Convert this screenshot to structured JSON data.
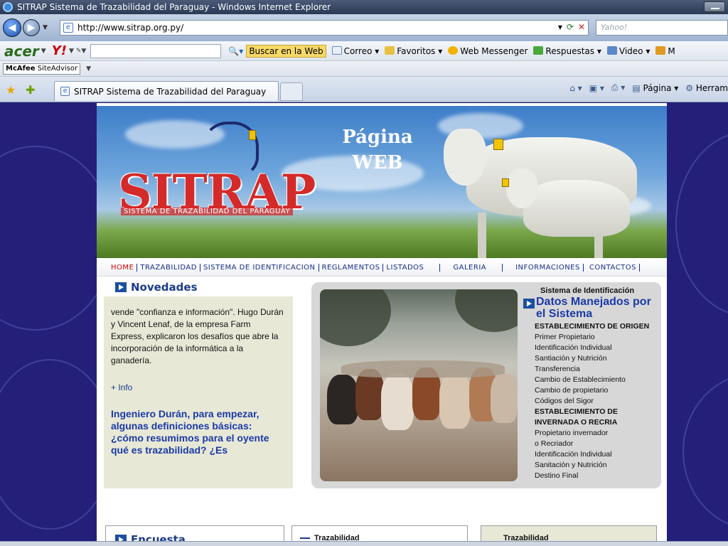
{
  "window": {
    "title": "SITRAP Sistema de Trazabilidad del Paraguay - Windows Internet Explorer"
  },
  "address_bar": {
    "url": "http://www.sitrap.org.py/",
    "search_placeholder": "Yahoo!"
  },
  "toolbar": {
    "brand": "acer",
    "yahoo": "Y!",
    "buscar_label": "Buscar en la Web",
    "items": [
      "Correo",
      "Favoritos",
      "Web Messenger",
      "Respuestas",
      "Video",
      "M"
    ]
  },
  "mcafee": {
    "brand": "McAfee",
    "label": "SiteAdvisor"
  },
  "tabs": {
    "active_label": "SITRAP Sistema de Trazabilidad del Paraguay",
    "commands": [
      "Página",
      "Herram"
    ]
  },
  "banner": {
    "logo_text": "SITRAP",
    "logo_subtitle": "SISTEMA DE TRAZABILIDAD DEL PARAGUAY",
    "overlay_line1": "Página",
    "overlay_line2": "WEB"
  },
  "menu": {
    "items": [
      "HOME",
      "TRAZABILIDAD",
      "SISTEMA DE IDENTIFICACION",
      "REGLAMENTOS",
      "LISTADOS",
      "GALERIA",
      "INFORMACIONES",
      "CONTACTOS"
    ]
  },
  "novedades": {
    "heading": "Novedades",
    "text": "vende \"confianza e información\". Hugo Durán y Vincent Lenaf, de la empresa Farm Express, explicaron los desafíos que abre la incorporación de la informática a la ganadería.",
    "more_link": "+ Info",
    "headline": "Ingeniero Durán, para empezar, algunas definiciones básicas: ¿cómo resumimos para el oyente qué es trazabilidad? ¿Es"
  },
  "datos": {
    "kicker": "Sistema de Identificación",
    "title": "Datos Manejados por el Sistema",
    "list": [
      {
        "text": "ESTABLECIMIENTO DE ORIGEN",
        "header": true
      },
      {
        "text": "Primer Propietario",
        "header": false
      },
      {
        "text": "Identificación Individual",
        "header": false
      },
      {
        "text": "Santiación y Nutrición",
        "header": false
      },
      {
        "text": "Transferencia",
        "header": false
      },
      {
        "text": "Cambio de Establecimiento",
        "header": false
      },
      {
        "text": "Cambio de propietario",
        "header": false
      },
      {
        "text": "Códigos del Sigor",
        "header": false
      },
      {
        "text": "ESTABLECIMIENTO DE",
        "header": true
      },
      {
        "text": "INVERNADA O RECRIA",
        "header": true
      },
      {
        "text": "Propietario invernador",
        "header": false
      },
      {
        "text": "o Recriador",
        "header": false
      },
      {
        "text": "Identificación Individual",
        "header": false
      },
      {
        "text": "Sanitación y Nutrición",
        "header": false
      },
      {
        "text": "Destino Final",
        "header": false
      }
    ]
  },
  "bottom": {
    "encuesta": "Encuesta",
    "traz1": "Trazabilidad",
    "traz2": "Trazabilidad"
  },
  "colors": {
    "page_bg": "#24207a",
    "link_blue": "#1b3aa8",
    "menu_active": "#dd0000",
    "logo_red": "#d42a2a"
  }
}
